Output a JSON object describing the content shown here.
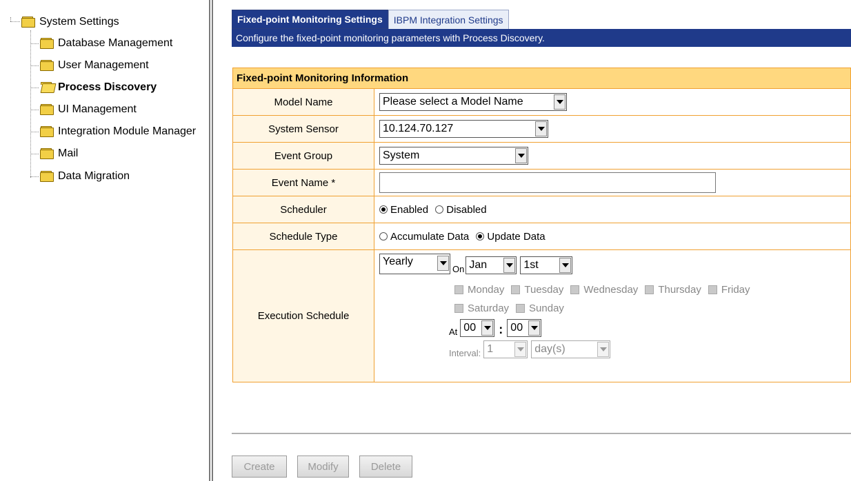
{
  "tree": {
    "root": "System Settings",
    "children": [
      {
        "label": "Database Management"
      },
      {
        "label": "User Management"
      },
      {
        "label": "Process Discovery",
        "selected": true
      },
      {
        "label": "UI Management"
      },
      {
        "label": "Integration Module Manager"
      },
      {
        "label": "Mail"
      },
      {
        "label": "Data Migration"
      }
    ]
  },
  "tabs": [
    {
      "label": "Fixed-point Monitoring Settings",
      "active": true
    },
    {
      "label": "IBPM Integration Settings",
      "active": false
    }
  ],
  "description": "Configure the fixed-point monitoring parameters with Process Discovery.",
  "form": {
    "header": "Fixed-point Monitoring Information",
    "model_name": {
      "label": "Model Name",
      "value": "Please select a Model Name"
    },
    "system_sensor": {
      "label": "System Sensor",
      "value": "10.124.70.127"
    },
    "event_group": {
      "label": "Event Group",
      "value": "System"
    },
    "event_name": {
      "label": "Event Name *",
      "value": ""
    },
    "scheduler": {
      "label": "Scheduler",
      "options": [
        "Enabled",
        "Disabled"
      ],
      "selected": "Enabled"
    },
    "schedule_type": {
      "label": "Schedule Type",
      "options": [
        "Accumulate Data",
        "Update Data"
      ],
      "selected": "Update Data"
    },
    "execution_schedule": {
      "label": "Execution Schedule",
      "frequency": "Yearly",
      "on_label": "On",
      "month": "Jan",
      "day": "1st",
      "weekdays": [
        "Monday",
        "Tuesday",
        "Wednesday",
        "Thursday",
        "Friday",
        "Saturday",
        "Sunday"
      ],
      "at_label": "At",
      "hour": "00",
      "time_sep": ":",
      "minute": "00",
      "interval_label": "Interval:",
      "interval_value": "1",
      "interval_unit": "day(s)"
    }
  },
  "buttons": {
    "create": "Create",
    "modify": "Modify",
    "delete": "Delete"
  }
}
